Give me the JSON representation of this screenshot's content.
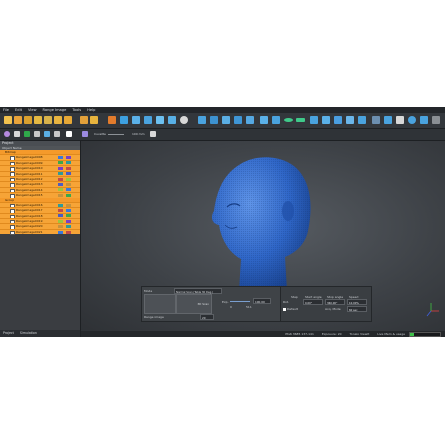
{
  "menu": [
    "File",
    "Edit",
    "View",
    "Range Image",
    "Tools",
    "Help"
  ],
  "project_panel": {
    "title": "Project",
    "column_header": "Object Name",
    "groups": [
      {
        "name": "Bitmap",
        "items": [
          "RangeImage0008",
          "RangeImage0009",
          "RangeImage0010",
          "RangeImage0011",
          "RangeImage0012",
          "RangeImage0013",
          "RangeImage0014",
          "RangeImage0015"
        ]
      },
      {
        "name": "Group",
        "items": [
          "RangeImage0016",
          "RangeImage0017",
          "RangeImage0018",
          "RangeImage0019",
          "RangeImage0020",
          "RangeImage0021"
        ]
      }
    ],
    "swatch_colors": [
      "#3c78d8",
      "#3ea84a",
      "#7a3fc4",
      "#2f9a9a",
      "#c24a4a",
      "#4a5dc4",
      "#9bc43e",
      "#c4923e"
    ]
  },
  "tabs": [
    "Project",
    "Simulation"
  ],
  "toolbar2": {
    "label": "Cuvette",
    "value": "100 mm"
  },
  "scan_panel": {
    "mode_label": "Mode",
    "mode_value": "Normal Scan (Table 30 Deg.)",
    "scan_label": "3D Scan",
    "range_label": "Range image",
    "count_value": "20",
    "exposure_label": "Exp.",
    "exposure_min": "0",
    "exposure_max": "511",
    "exposure_value": "100.00"
  },
  "scan_panel2": {
    "step_label": "Step",
    "start_label": "Start angle",
    "stop_label": "Stop angle",
    "speed_label": "Speed",
    "rotate_label": "Rot.",
    "start_value": "0.00°",
    "stop_value": "360.00°",
    "speed_value": "10.00%",
    "default_label": "Default",
    "fps_label": "Acq. Mode",
    "fps_value": "60 sec"
  },
  "status": {
    "points": "Pts6 3685 137-141",
    "exposure": "Exposure: 20",
    "viewer": "Tonalo ViewIt",
    "memory": "Live Mem & usage",
    "progress": 0.12
  },
  "colors": {
    "mesh": "#2f66c7",
    "accent_orange": "#f6a437",
    "background": "#2c2f33"
  }
}
